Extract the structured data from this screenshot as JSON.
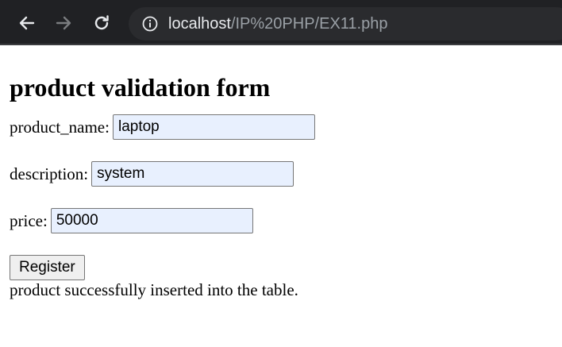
{
  "browser": {
    "url_host": "localhost",
    "url_path": "/IP%20PHP/EX11.php",
    "icons": {
      "back": "arrow-left-icon",
      "forward": "arrow-right-icon",
      "reload": "reload-icon",
      "site_info": "info-icon"
    }
  },
  "page": {
    "heading": "product validation form",
    "fields": [
      {
        "label": "product_name:",
        "value": "laptop"
      },
      {
        "label": "description:",
        "value": "system"
      },
      {
        "label": "price:",
        "value": "50000"
      }
    ],
    "submit_label": "Register",
    "message": "product successfully inserted into the table."
  }
}
